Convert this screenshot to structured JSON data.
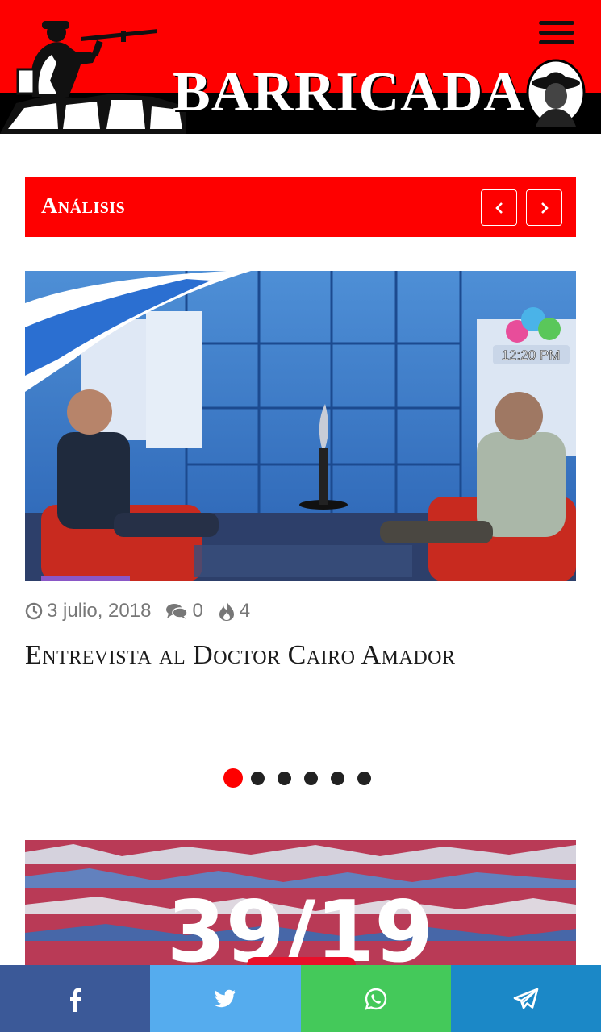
{
  "header": {
    "brand": "BARRICADA",
    "menu_icon": "hamburger-menu-icon",
    "colors": {
      "red": "#fe0000",
      "black": "#000000"
    }
  },
  "section": {
    "title": "Análisis",
    "prev_icon": "chevron-left-icon",
    "next_icon": "chevron-right-icon"
  },
  "article": {
    "date": "3 julio, 2018",
    "comments": "0",
    "views": "4",
    "title": "Entrevista al Doctor Cairo Amador",
    "image_overlay_time": "12:20 PM"
  },
  "slider": {
    "total": 6,
    "active": 1
  },
  "second_article": {
    "image_text": "39/19"
  },
  "share": [
    {
      "name": "facebook",
      "icon": "facebook-icon",
      "color": "#3b5998"
    },
    {
      "name": "twitter",
      "icon": "twitter-icon",
      "color": "#55acee"
    },
    {
      "name": "whatsapp",
      "icon": "whatsapp-icon",
      "color": "#44c95a"
    },
    {
      "name": "telegram",
      "icon": "telegram-icon",
      "color": "#1b88c7"
    }
  ]
}
